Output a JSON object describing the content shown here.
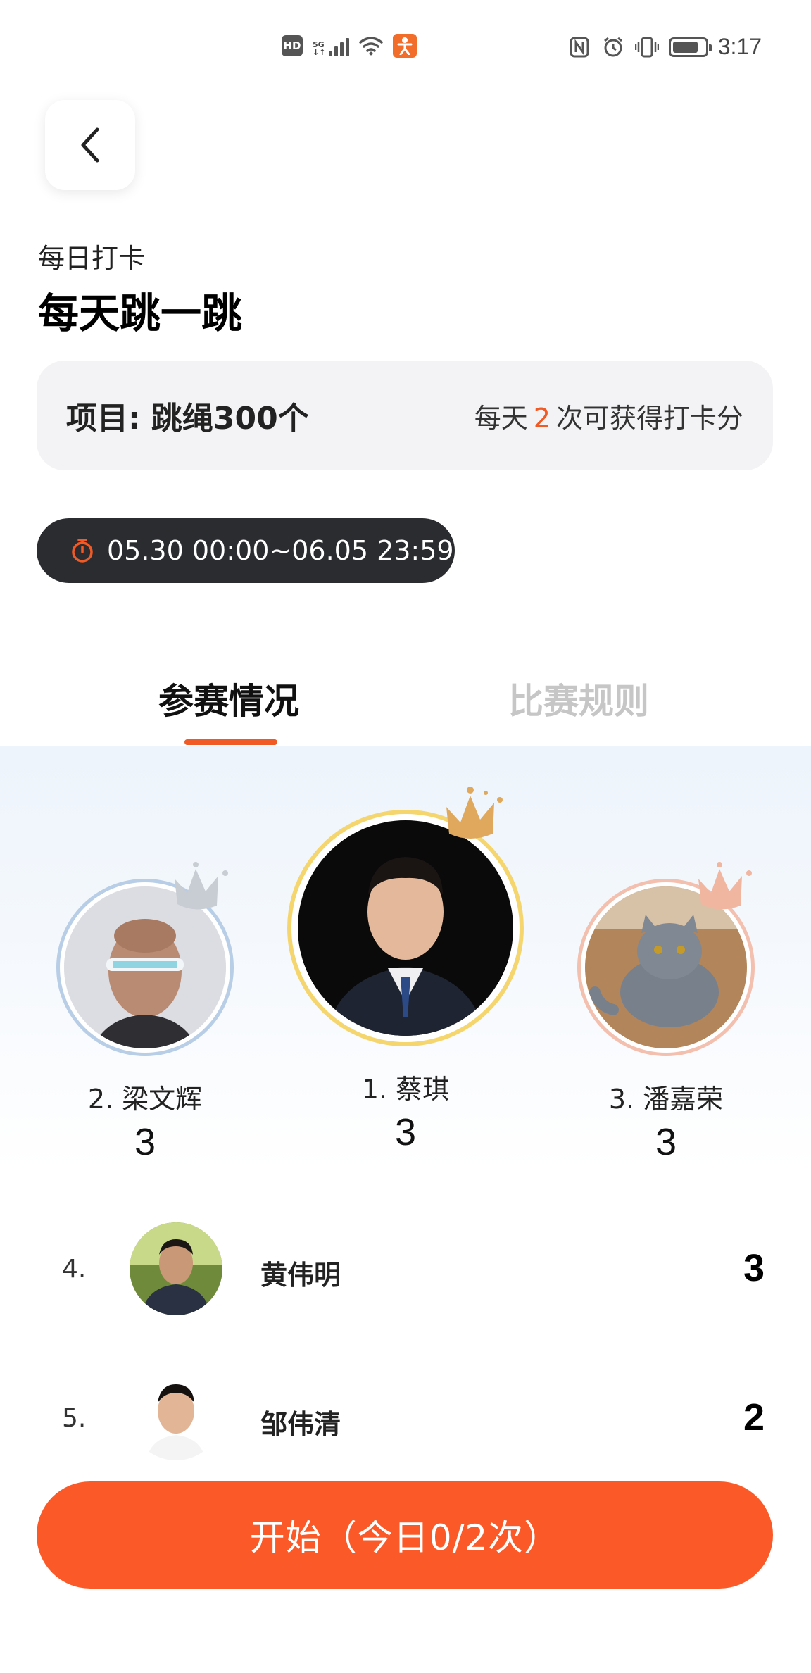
{
  "status_bar": {
    "hd": "HD",
    "network": "5G",
    "time": "3:17",
    "icons": [
      "hd-icon",
      "signal-icon",
      "wifi-icon",
      "app-notification-icon",
      "nfc-icon",
      "alarm-icon",
      "vibrate-icon",
      "battery-icon"
    ],
    "battery_level": 0.8
  },
  "header": {
    "back_icon": "chevron-left-icon",
    "subtitle": "每日打卡",
    "title": "每天跳一跳"
  },
  "info": {
    "project": "项目: 跳绳300个",
    "daily_prefix": "每天",
    "daily_count": "2",
    "daily_suffix": "次可获得打卡分"
  },
  "time_range": {
    "icon": "stopwatch-icon",
    "text": "05.30 00:00~06.05 23:59"
  },
  "tabs": [
    {
      "label": "参赛情况",
      "active": true
    },
    {
      "label": "比赛规则",
      "active": false
    }
  ],
  "podium": [
    {
      "rank_name": "1. 蔡琪",
      "score": "3",
      "crown_color": "#e0a85c"
    },
    {
      "rank_name": "2. 梁文辉",
      "score": "3",
      "crown_color": "#c8ccd3"
    },
    {
      "rank_name": "3. 潘嘉荣",
      "score": "3",
      "crown_color": "#f1b6a0"
    }
  ],
  "list": [
    {
      "rank": "4.",
      "name": "黄伟明",
      "score": "3"
    },
    {
      "rank": "5.",
      "name": "邹伟清",
      "score": "2"
    }
  ],
  "start_button": {
    "label": "开始（今日0/2次）"
  },
  "colors": {
    "accent": "#f15a24",
    "button": "#fb5a28",
    "pill": "#2b2c2f",
    "gold_ring": "#f5d66e",
    "silver_ring": "#b8cde6",
    "bronze_ring": "#f3bfae"
  }
}
